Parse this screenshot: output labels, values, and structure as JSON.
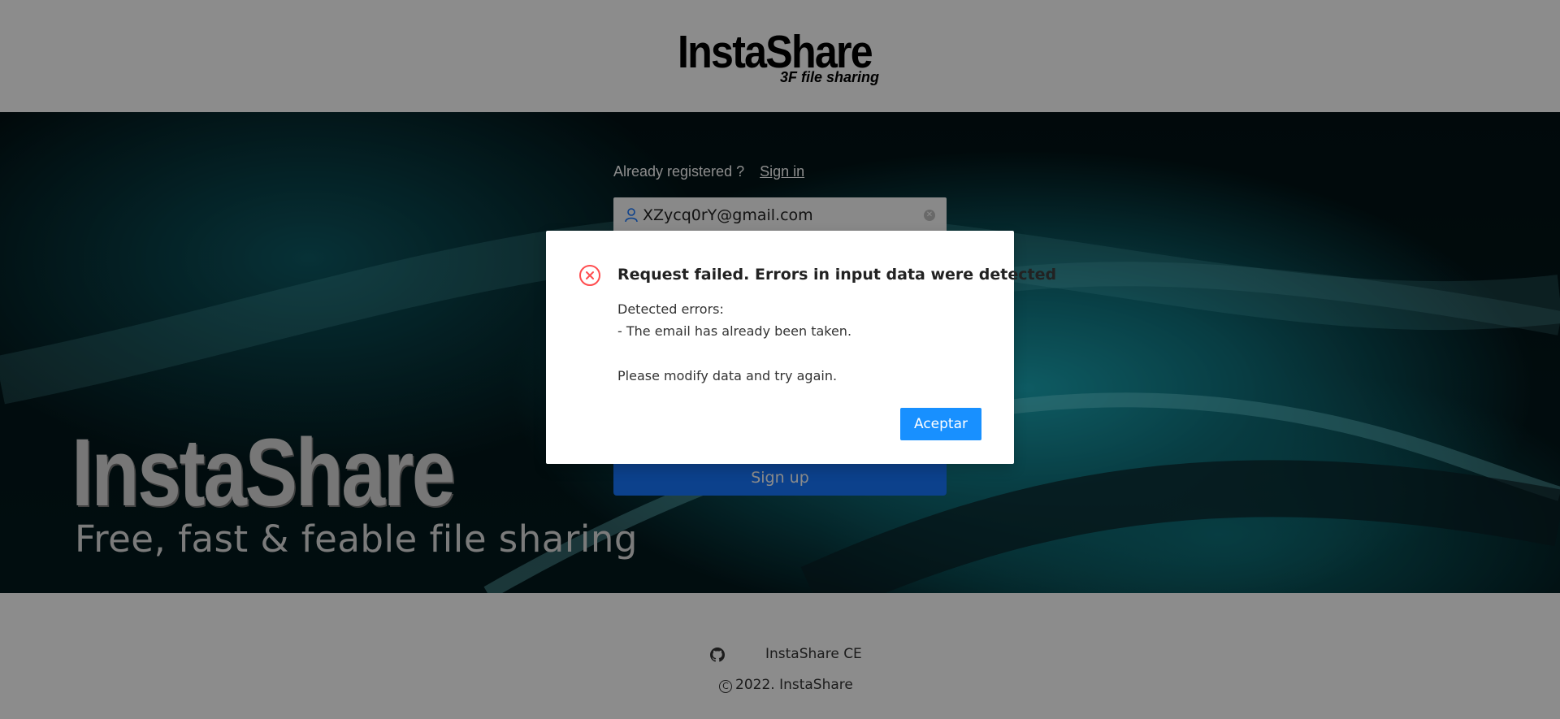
{
  "header": {
    "logo_main": "InstaShare",
    "logo_sub": "3F file sharing"
  },
  "hero": {
    "title": "InstaShare",
    "tagline": "Free, fast & feable file sharing"
  },
  "form": {
    "already_label": "Already registered ?",
    "sign_in_link": "Sign in",
    "email_value": "XZycq0rY@gmail.com",
    "signup_label": "Sign up"
  },
  "footer": {
    "link_text": "InstaShare CE",
    "copyright": "2022. InstaShare",
    "copyright_symbol": "C"
  },
  "modal": {
    "title": "Request failed. Errors in input data were detected",
    "body_line1": "Detected errors:",
    "body_line2": "- The email has already been taken.",
    "body_line3": "Please modify data and try again.",
    "ok_label": "Aceptar",
    "error_color": "#ff4d4f",
    "button_color": "#1890ff"
  },
  "icons": {
    "user": "user-icon",
    "clear": "clear-icon",
    "github": "github-icon",
    "copyright": "copyright-icon",
    "error": "error-icon"
  }
}
